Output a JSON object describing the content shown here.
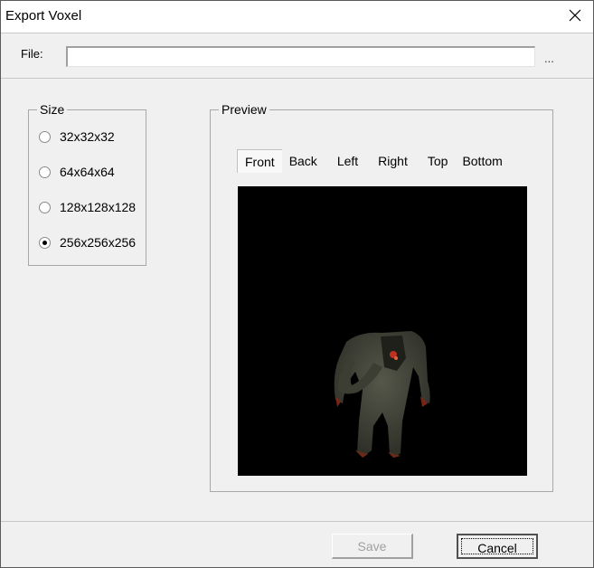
{
  "window": {
    "title": "Export Voxel",
    "close_icon": "close-icon"
  },
  "file": {
    "label": "File:",
    "value": "",
    "placeholder": "",
    "browse_label": "..."
  },
  "size": {
    "legend": "Size",
    "options": [
      {
        "label": "32x32x32",
        "checked": false
      },
      {
        "label": "64x64x64",
        "checked": false
      },
      {
        "label": "128x128x128",
        "checked": false
      },
      {
        "label": "256x256x256",
        "checked": true
      }
    ]
  },
  "preview": {
    "legend": "Preview",
    "tabs": [
      {
        "label": "Front",
        "active": true
      },
      {
        "label": "Back",
        "active": false
      },
      {
        "label": "Left",
        "active": false
      },
      {
        "label": "Right",
        "active": false
      },
      {
        "label": "Top",
        "active": false
      },
      {
        "label": "Bottom",
        "active": false
      }
    ],
    "image": "voxel-creature-front-view"
  },
  "buttons": {
    "save_label": "Save",
    "save_enabled": false,
    "cancel_label": "Cancel"
  }
}
